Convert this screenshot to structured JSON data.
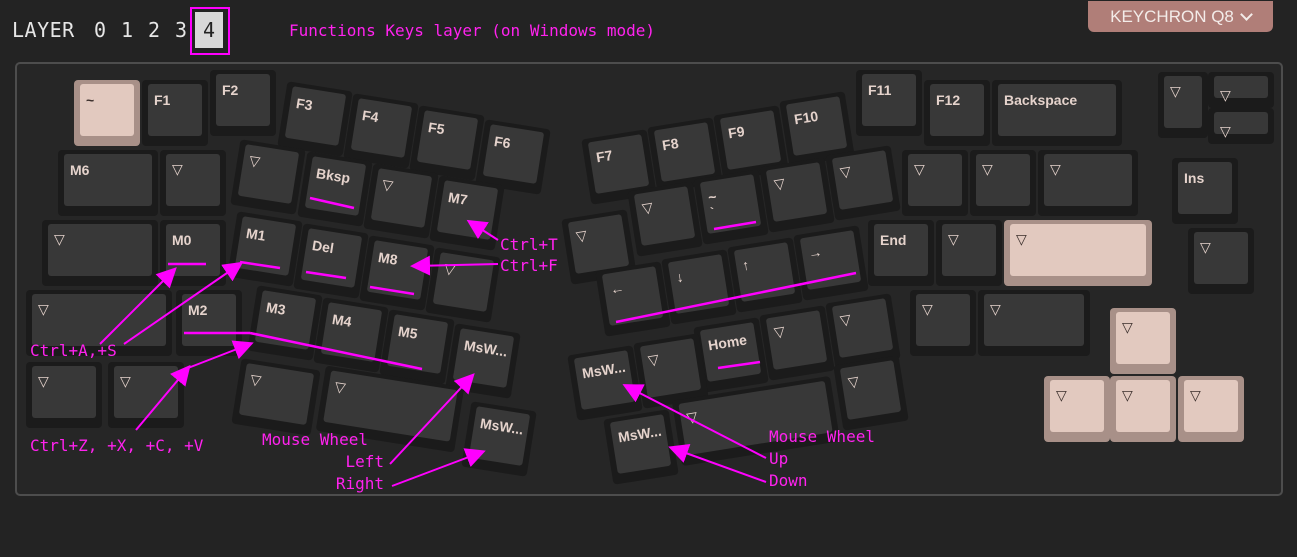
{
  "header": {
    "layer_label": "LAYER",
    "layers": [
      "0",
      "1",
      "2",
      "3",
      "4"
    ],
    "active_layer": "4",
    "description": "Functions Keys layer (on Windows mode)",
    "model_selector": "KEYCHRON Q8"
  },
  "colors": {
    "annotation": "#ff00ff",
    "light_key": "#e2c9bf",
    "model_button": "#b07e78"
  },
  "keys": {
    "tilde": "~",
    "f1": "F1",
    "f2": "F2",
    "f3": "F3",
    "f4": "F4",
    "f5": "F5",
    "f6": "F6",
    "f7": "F7",
    "f8": "F8",
    "f9": "F9",
    "f10": "F10",
    "f11": "F11",
    "f12": "F12",
    "backspace": "Backspace",
    "trans": "▽",
    "m0": "M0",
    "m1": "M1",
    "m2": "M2",
    "m3": "M3",
    "m4": "M4",
    "m5": "M5",
    "m6": "M6",
    "m7": "M7",
    "m8": "M8",
    "bksp": "Bksp",
    "del": "Del",
    "ins": "Ins",
    "end": "End",
    "home": "Home",
    "mswheel": "MsW...",
    "tilde_top": "~",
    "tilde_bottom": "`",
    "arrow_left": "←",
    "arrow_down": "↓",
    "arrow_up": "↑",
    "arrow_right": "→"
  },
  "annotations": {
    "ctrl_t": "Ctrl+T",
    "ctrl_f": "Ctrl+F",
    "ctrl_as": "Ctrl+A,+S",
    "ctrl_zxcv": "Ctrl+Z, +X, +C, +V",
    "mouse_wheel_left_1": "Mouse Wheel",
    "mouse_wheel_left_2": "Left",
    "mouse_wheel_left_3": "Right",
    "mouse_wheel_right_1": "Mouse Wheel",
    "mouse_wheel_right_2": "Up",
    "mouse_wheel_right_3": "Down"
  }
}
